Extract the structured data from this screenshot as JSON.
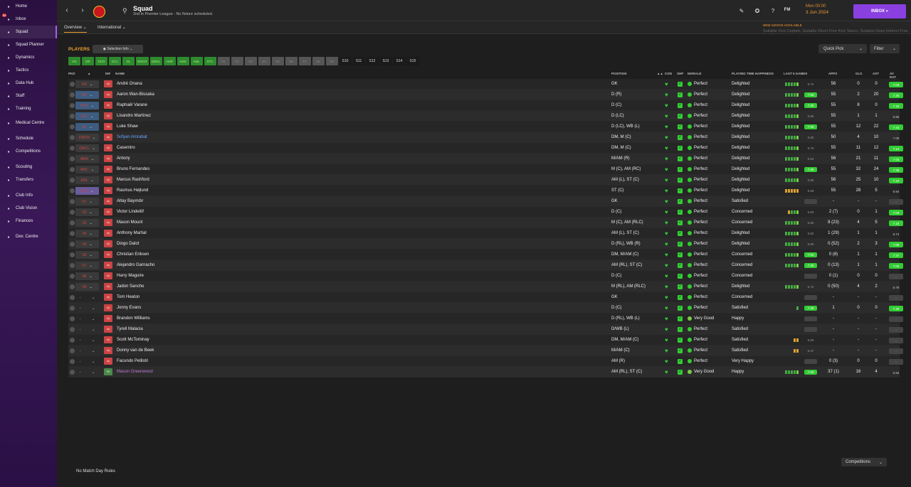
{
  "sidebar": {
    "items": [
      {
        "label": "Home",
        "icon": "home-icon"
      },
      {
        "label": "Inbox",
        "icon": "inbox-icon",
        "badge": "99"
      },
      {
        "label": "Squad",
        "icon": "shirt-icon",
        "active": true
      },
      {
        "label": "Squad Planner",
        "icon": "planner-icon"
      },
      {
        "label": "Dynamics",
        "icon": "dynamics-icon"
      },
      {
        "label": "Tactics",
        "icon": "tactics-icon"
      },
      {
        "label": "Data Hub",
        "icon": "data-hub-icon"
      },
      {
        "label": "Staff",
        "icon": "staff-icon"
      },
      {
        "label": "Training",
        "icon": "training-icon"
      },
      {
        "label": "Medical Centre",
        "icon": "medical-icon"
      },
      {
        "label": "Schedule",
        "icon": "calendar-icon"
      },
      {
        "label": "Competitions",
        "icon": "trophy-icon"
      },
      {
        "label": "Scouting",
        "icon": "scouting-icon"
      },
      {
        "label": "Transfers",
        "icon": "transfers-icon"
      },
      {
        "label": "Club Info",
        "icon": "club-info-icon"
      },
      {
        "label": "Club Vision",
        "icon": "club-vision-icon"
      },
      {
        "label": "Finances",
        "icon": "finances-icon"
      },
      {
        "label": "Dev. Centre",
        "icon": "dev-centre-icon"
      }
    ]
  },
  "header": {
    "title": "Squad",
    "subtitle": "2nd in Premier League - No fixture scheduled.",
    "day": "Mon 00:00",
    "date": "3 Jun 2024",
    "inbox": "INBOX"
  },
  "subnav": {
    "tab1": "Overview",
    "tab2": "International",
    "advice_title": "NEW ADVICE AVAILABLE",
    "advice_text": "Suitable Vice Captain, Suitable Direct Free Kick Takers, Suitable Deep Indirect Free Kick Takers"
  },
  "toolbar": {
    "players": "PLAYERS",
    "selection_info": "Selection Info",
    "quick_pick": "Quick Pick",
    "filter": "Filter"
  },
  "chips": [
    {
      "t": "GK",
      "k": "g"
    },
    {
      "t": "DR",
      "k": "g"
    },
    {
      "t": "DCR",
      "k": "g"
    },
    {
      "t": "DCL",
      "k": "g"
    },
    {
      "t": "DL",
      "k": "g"
    },
    {
      "t": "DMCR",
      "k": "g"
    },
    {
      "t": "DMCL",
      "k": "g"
    },
    {
      "t": "AMR",
      "k": "g"
    },
    {
      "t": "AMC",
      "k": "g"
    },
    {
      "t": "AML",
      "k": "g"
    },
    {
      "t": "STC",
      "k": "g"
    },
    {
      "t": "S1",
      "k": "d"
    },
    {
      "t": "S2",
      "k": "d"
    },
    {
      "t": "S3",
      "k": "d"
    },
    {
      "t": "S4",
      "k": "d"
    },
    {
      "t": "S5",
      "k": "d"
    },
    {
      "t": "S6",
      "k": "d"
    },
    {
      "t": "S7",
      "k": "d"
    },
    {
      "t": "S8",
      "k": "d"
    },
    {
      "t": "S9",
      "k": "d"
    },
    {
      "t": "S10",
      "k": "s"
    },
    {
      "t": "S11",
      "k": "s"
    },
    {
      "t": "S12",
      "k": "s"
    },
    {
      "t": "S13",
      "k": "s"
    },
    {
      "t": "S14",
      "k": "s"
    },
    {
      "t": "S15",
      "k": "s"
    }
  ],
  "columns": {
    "pkd": "PKD",
    "inf": "INF",
    "name": "NAME",
    "position": "POSITION",
    "con": "CON",
    "shp": "SHP",
    "morale": "MORALE",
    "pth": "PLAYING TIME HAPPINESS",
    "last5": "LAST 5 GAMES",
    "apps": "APPS",
    "gls": "GLS",
    "ast": "AST",
    "avrat": "AV RAT"
  },
  "players": [
    {
      "pos": "GK",
      "pc": "b",
      "inf": "Inj",
      "name": "André Onana",
      "position": "GK",
      "morale": "Perfect",
      "pth": "Delighted",
      "form": "aaaab",
      "lr": "6.72",
      "lrh": false,
      "apps": "56",
      "gls": "0",
      "ast": "0",
      "avr": "7.03",
      "avrh": true
    },
    {
      "pos": "DR",
      "pc": "s",
      "inf": "Inj",
      "name": "Aaron Wan-Bissaka",
      "position": "D (R)",
      "morale": "Perfect",
      "pth": "Delighted",
      "form": "aaaab",
      "lr": "7.50",
      "lrh": true,
      "apps": "55",
      "gls": "2",
      "ast": "20",
      "avr": "7.30",
      "avrh": true
    },
    {
      "pos": "DCR",
      "pc": "s",
      "inf": "Inj",
      "name": "Raphaël Varane",
      "position": "D (C)",
      "morale": "Perfect",
      "pth": "Delighted",
      "form": "aaaab",
      "lr": "7.00",
      "lrh": true,
      "apps": "55",
      "gls": "8",
      "ast": "0",
      "avr": "7.18",
      "avrh": true
    },
    {
      "pos": "DCL",
      "pc": "s",
      "inf": "Inj",
      "name": "Lisandro Martínez",
      "position": "D (LC)",
      "morale": "Perfect",
      "pth": "Delighted",
      "form": "aaaab",
      "lr": "6.86",
      "lrh": false,
      "apps": "55",
      "gls": "1",
      "ast": "1",
      "avr": "6.90",
      "avrh": false
    },
    {
      "pos": "DL",
      "pc": "s",
      "inf": "Inj",
      "name": "Luke Shaw",
      "position": "D (LC), WB (L)",
      "morale": "Perfect",
      "pth": "Delighted",
      "form": "aaaab",
      "lr": "7.00",
      "lrh": true,
      "apps": "55",
      "gls": "12",
      "ast": "22",
      "avr": "7.43",
      "avrh": true
    },
    {
      "pos": "DMCR",
      "pc": "b",
      "inf": "Inj",
      "name": "Sofyan Amrabat",
      "nc": "blue",
      "position": "DM, M (C)",
      "morale": "Perfect",
      "pth": "Delighted",
      "form": "aaaab",
      "lr": "6.80",
      "lrh": false,
      "apps": "50",
      "gls": "4",
      "ast": "10",
      "avr": "7.00",
      "avrh": false
    },
    {
      "pos": "DMCL",
      "pc": "b",
      "inf": "Inj",
      "name": "Casemiro",
      "position": "DM, M (C)",
      "morale": "Perfect",
      "pth": "Delighted",
      "form": "aaaab",
      "lr": "6.70",
      "lrh": false,
      "apps": "55",
      "gls": "11",
      "ast": "12",
      "avr": "7.14",
      "avrh": true
    },
    {
      "pos": "AMR",
      "pc": "b",
      "inf": "Inj",
      "name": "Antony",
      "position": "M/AM (R)",
      "morale": "Perfect",
      "pth": "Delighted",
      "form": "aaaab",
      "lr": "6.62",
      "lrh": false,
      "apps": "56",
      "gls": "21",
      "ast": "11",
      "avr": "7.03",
      "avrh": true
    },
    {
      "pos": "AMC",
      "pc": "b",
      "inf": "Inj",
      "name": "Bruno Fernandes",
      "position": "M (C), AM (RC)",
      "morale": "Perfect",
      "pth": "Delighted",
      "form": "aaaab",
      "lr": "7.06",
      "lrh": true,
      "apps": "55",
      "gls": "32",
      "ast": "24",
      "avr": "7.38",
      "avrh": true
    },
    {
      "pos": "AML",
      "pc": "b",
      "inf": "Inj",
      "name": "Marcus Rashford",
      "position": "AM (L), ST (C)",
      "morale": "Perfect",
      "pth": "Delighted",
      "form": "aaaab",
      "lr": "6.86",
      "lrh": false,
      "apps": "56",
      "gls": "25",
      "ast": "10",
      "avr": "7.22",
      "avrh": true
    },
    {
      "pos": "STC",
      "pc": "st",
      "inf": "Inj",
      "name": "Rasmus Højlund",
      "position": "ST (C)",
      "morale": "Perfect",
      "pth": "Delighted",
      "form": "ccccc",
      "lr": "6.68",
      "lrh": false,
      "apps": "55",
      "gls": "28",
      "ast": "5",
      "avr": "6.94",
      "avrh": false
    },
    {
      "pos": "S1",
      "pc": "b",
      "inf": "Inj",
      "name": "Altay Bayındır",
      "position": "GK",
      "morale": "Perfect",
      "pth": "Satisfied",
      "form": "",
      "lr": "-",
      "lrh": false,
      "lrd": true,
      "apps": "-",
      "gls": "-",
      "ast": "-",
      "avr": "-",
      "avrh": false,
      "avrd": true
    },
    {
      "pos": "S2",
      "pc": "b",
      "inf": "Inj",
      "name": "Victor Lindelöf",
      "position": "D (C)",
      "morale": "Perfect",
      "pth": "Concerned",
      "form": "caab",
      "lr": "6.83",
      "lrh": false,
      "apps": "2 (7)",
      "gls": "0",
      "ast": "1",
      "avr": "7.03",
      "avrh": true
    },
    {
      "pos": "S3",
      "pc": "b",
      "inf": "Inj",
      "name": "Mason Mount",
      "position": "M (C), AM (RLC)",
      "morale": "Perfect",
      "pth": "Concerned",
      "form": "aaaab",
      "lr": "6.80",
      "lrh": false,
      "apps": "8 (23)",
      "gls": "4",
      "ast": "5",
      "avr": "7.18",
      "avrh": true
    },
    {
      "pos": "S4",
      "pc": "b",
      "inf": "Inj",
      "name": "Anthony Martial",
      "position": "AM (L), ST (C)",
      "morale": "Perfect",
      "pth": "Delighted",
      "form": "aaaab",
      "lr": "6.82",
      "lrh": false,
      "apps": "1 (29)",
      "gls": "1",
      "ast": "1",
      "avr": "6.74",
      "avrh": false
    },
    {
      "pos": "S5",
      "pc": "b",
      "inf": "Inj",
      "name": "Diogo Dalot",
      "position": "D (RL), WB (R)",
      "morale": "Perfect",
      "pth": "Delighted",
      "form": "aaaab",
      "lr": "6.90",
      "lrh": false,
      "apps": "0 (52)",
      "gls": "2",
      "ast": "3",
      "avr": "7.06",
      "avrh": true
    },
    {
      "pos": "S6",
      "pc": "b",
      "inf": "Inj",
      "name": "Christian Eriksen",
      "position": "DM, M/AM (C)",
      "morale": "Perfect",
      "pth": "Concerned",
      "form": "aaaab",
      "lr": "7.02",
      "lrh": true,
      "apps": "0 (8)",
      "gls": "1",
      "ast": "1",
      "avr": "7.37",
      "avrh": true
    },
    {
      "pos": "S7",
      "pc": "b",
      "inf": "Inj",
      "name": "Alejandro Garnacho",
      "position": "AM (RL), ST (C)",
      "morale": "Perfect",
      "pth": "Concerned",
      "form": "aaaab",
      "lr": "7.28",
      "lrh": true,
      "apps": "0 (13)",
      "gls": "1",
      "ast": "1",
      "avr": "7.03",
      "avrh": true
    },
    {
      "pos": "S8",
      "pc": "b",
      "inf": "Inj",
      "name": "Harry Maguire",
      "position": "D (C)",
      "morale": "Perfect",
      "pth": "Concerned",
      "form": "",
      "lr": "-",
      "lrh": false,
      "lrd": true,
      "apps": "0 (1)",
      "gls": "0",
      "ast": "0",
      "avr": "-",
      "avrh": false,
      "avrd": true
    },
    {
      "pos": "S9",
      "pc": "b",
      "inf": "Inj",
      "name": "Jadon Sancho",
      "position": "M (RL), AM (RLC)",
      "morale": "Perfect",
      "pth": "Delighted",
      "form": "aaaab",
      "lr": "6.72",
      "lrh": false,
      "apps": "0 (50)",
      "gls": "4",
      "ast": "2",
      "avr": "6.79",
      "avrh": false
    },
    {
      "pos": "-",
      "pc": "r",
      "inf": "Inj",
      "name": "Tom Heaton",
      "position": "GK",
      "morale": "Perfect",
      "pth": "Concerned",
      "form": "",
      "lr": "-",
      "lrh": false,
      "lrd": true,
      "apps": "-",
      "gls": "-",
      "ast": "-",
      "avr": "-",
      "avrh": false,
      "avrd": true
    },
    {
      "pos": "-",
      "pc": "r",
      "inf": "Inj",
      "name": "Jonny Evans",
      "position": "D (C)",
      "morale": "Perfect",
      "pth": "Satisfied",
      "form": "a",
      "lr": "7.30",
      "lrh": true,
      "apps": "1",
      "gls": "0",
      "ast": "0",
      "avr": "7.30",
      "avrh": true
    },
    {
      "pos": "-",
      "pc": "r",
      "inf": "Inj",
      "name": "Brandon Williams",
      "position": "D (RL), WB (L)",
      "morale": "Very Good",
      "mc": "vg",
      "pth": "Happy",
      "form": "",
      "lr": "-",
      "lrh": false,
      "lrd": true,
      "apps": "-",
      "gls": "-",
      "ast": "-",
      "avr": "-",
      "avrh": false,
      "avrd": true
    },
    {
      "pos": "-",
      "pc": "r",
      "inf": "Inj",
      "name": "Tyrell Malacia",
      "position": "D/WB (L)",
      "morale": "Perfect",
      "pth": "Satisfied",
      "form": "",
      "lr": "-",
      "lrh": false,
      "lrd": true,
      "apps": "-",
      "gls": "-",
      "ast": "-",
      "avr": "-",
      "avrh": false,
      "avrd": true
    },
    {
      "pos": "-",
      "pc": "r",
      "inf": "Inj",
      "name": "Scott McTominay",
      "position": "DM, M/AM (C)",
      "morale": "Perfect",
      "pth": "Satisfied",
      "form": "cc",
      "lr": "6.50",
      "lrh": false,
      "apps": "-",
      "gls": "-",
      "ast": "-",
      "avr": "-",
      "avrh": false,
      "avrd": true
    },
    {
      "pos": "-",
      "pc": "r",
      "inf": "Inj",
      "name": "Donny van de Beek",
      "position": "M/AM (C)",
      "morale": "Perfect",
      "pth": "Satisfied",
      "form": "cc",
      "lr": "6.47",
      "lrh": false,
      "apps": "-",
      "gls": "-",
      "ast": "-",
      "avr": "-",
      "avrh": false,
      "avrd": true
    },
    {
      "pos": "-",
      "pc": "r",
      "inf": "Inj",
      "name": "Facundo Pellistri",
      "position": "AM (R)",
      "morale": "Perfect",
      "pth": "Very Happy",
      "form": "",
      "lr": "-",
      "lrh": false,
      "lrd": true,
      "apps": "0 (3)",
      "gls": "0",
      "ast": "0",
      "avr": "-",
      "avrh": false,
      "avrd": true
    },
    {
      "pos": "-",
      "pc": "r",
      "inf": "Fit",
      "infg": true,
      "name": "Mason Greenwood",
      "nc": "purple",
      "position": "AM (RL), ST (C)",
      "morale": "Very Good",
      "mc": "vg",
      "pth": "Happy",
      "form": "aaaab",
      "lr": "7.00",
      "lrh": true,
      "apps": "37 (1)",
      "gls": "16",
      "ast": "4",
      "avr": "6.94",
      "avrh": false
    }
  ],
  "footer": {
    "rules": "No Match Day Rules",
    "competitions": "Competitions"
  }
}
